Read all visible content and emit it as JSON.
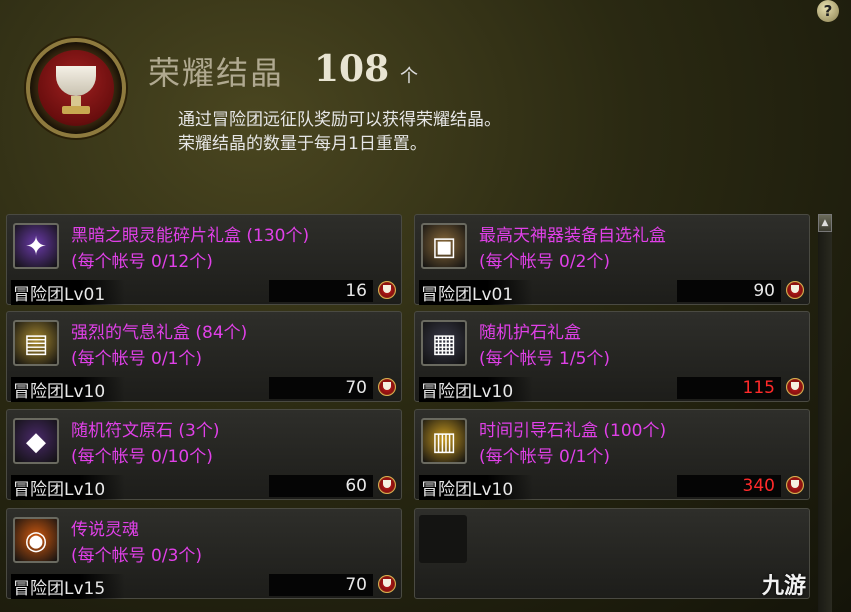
{
  "help": {
    "label": "?"
  },
  "header": {
    "title": "荣耀结晶",
    "count": "108",
    "unit": "个",
    "desc_line1": "通过冒险团远征队奖励可以获得荣耀结晶。",
    "desc_line2": "荣耀结晶的数量于每月1日重置。"
  },
  "scroll": {
    "up_label": "▲"
  },
  "items": [
    {
      "name": "黑暗之眼灵能碎片礼盒 (130个)",
      "limit": "(每个帐号 0/12个)",
      "req": "冒险团Lv01",
      "price": "16",
      "price_red": false,
      "icon": "crystal-shards-icon",
      "icon_color": "#6a3aa8",
      "glyph": "✦"
    },
    {
      "name": "最高天神器装备自选礼盒",
      "limit": "(每个帐号 0/2个)",
      "req": "冒险团Lv01",
      "price": "90",
      "price_red": false,
      "icon": "treasure-chest-icon",
      "icon_color": "#8a6a3a",
      "glyph": "▣"
    },
    {
      "name": "强烈的气息礼盒 (84个)",
      "limit": "(每个帐号 0/1个)",
      "req": "冒险团Lv10",
      "price": "70",
      "price_red": false,
      "icon": "gold-chest-icon",
      "icon_color": "#a88a30",
      "glyph": "▤"
    },
    {
      "name": "随机护石礼盒",
      "limit": "(每个帐号 1/5个)",
      "req": "冒险团Lv10",
      "price": "115",
      "price_red": true,
      "icon": "dark-chest-icon",
      "icon_color": "#3a3a4a",
      "glyph": "▦"
    },
    {
      "name": "随机符文原石 (3个)",
      "limit": "(每个帐号 0/10个)",
      "req": "冒险团Lv10",
      "price": "60",
      "price_red": false,
      "icon": "rune-stones-icon",
      "icon_color": "#4a2a6a",
      "glyph": "◆"
    },
    {
      "name": "时间引导石礼盒 (100个)",
      "limit": "(每个帐号 0/1个)",
      "req": "冒险团Lv10",
      "price": "340",
      "price_red": true,
      "icon": "gold-gift-box-icon",
      "icon_color": "#c89a20",
      "glyph": "▥"
    },
    {
      "name": "传说灵魂",
      "limit": "(每个帐号 0/3个)",
      "req": "冒险团Lv15",
      "price": "70",
      "price_red": false,
      "icon": "legendary-soul-icon",
      "icon_color": "#d05a10",
      "glyph": "◉"
    }
  ],
  "watermark": {
    "text": "九游"
  },
  "colors": {
    "item_name": "#e040e8",
    "price_red": "#ff2a2a",
    "price_normal": "#e8e8e8"
  }
}
